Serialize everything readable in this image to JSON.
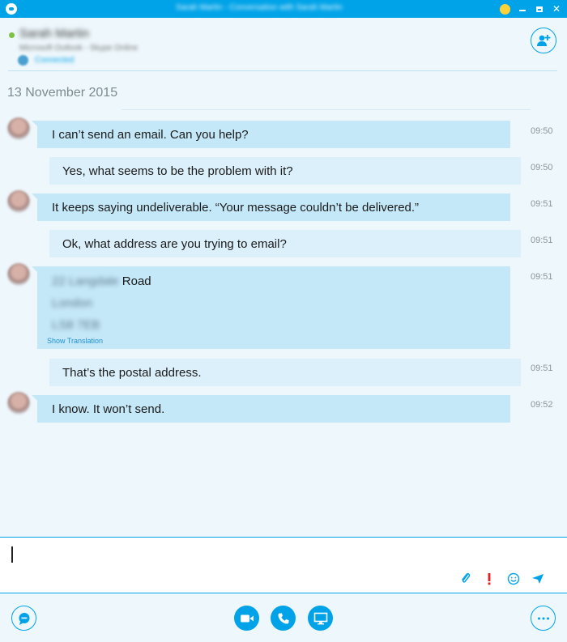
{
  "window": {
    "title": "Sarah Martin - Conversation with Sarah Martin"
  },
  "header": {
    "contact_name": "Sarah Martin",
    "contact_mood": "Microsoft Outlook - Skype Online",
    "location_text": "Connected",
    "presence_color": "#7ec242"
  },
  "conversation": {
    "date": "13 November 2015",
    "messages": [
      {
        "direction": "incoming",
        "text": "I can’t send an email. Can you help?",
        "time": "09:50"
      },
      {
        "direction": "outgoing",
        "text": "Yes, what seems to be the problem with it?",
        "time": "09:50"
      },
      {
        "direction": "incoming",
        "text": "It keeps saying undeliverable. “Your message couldn’t be delivered.”",
        "time": "09:51"
      },
      {
        "direction": "outgoing",
        "text": "Ok, what address are you trying to email?",
        "time": "09:51"
      },
      {
        "direction": "incoming",
        "address_line1_redacted": "22 Langdale",
        "address_line1_visible": "Road",
        "address_line2_redacted": "London",
        "address_line3_redacted": "LS8 7EB",
        "show_translation": "Show Translation",
        "time": "09:51"
      },
      {
        "direction": "outgoing",
        "text": "That’s the postal address.",
        "time": "09:51"
      },
      {
        "direction": "incoming",
        "text": "I know. It won’t send.",
        "time": "09:52"
      }
    ]
  },
  "compose": {
    "icons": [
      "paperclip-icon",
      "important-icon",
      "emoticon-icon",
      "send-icon"
    ]
  },
  "toolbar": {
    "buttons": [
      "chat-icon",
      "video-icon",
      "phone-icon",
      "screen-share-icon",
      "more-icon"
    ]
  },
  "colors": {
    "accent": "#00a3e8",
    "incoming_bubble": "#c5e8f9",
    "outgoing_bubble": "#dcf0fb",
    "important": "#e02020"
  }
}
